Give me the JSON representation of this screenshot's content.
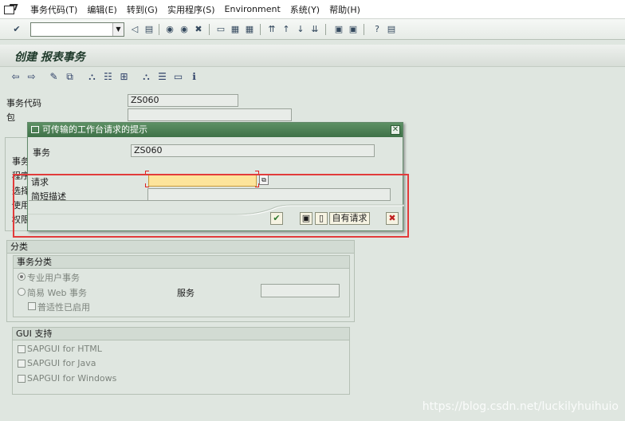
{
  "menubar": {
    "items": [
      {
        "label": "事务代码(T)"
      },
      {
        "label": "编辑(E)"
      },
      {
        "label": "转到(G)"
      },
      {
        "label": "实用程序(S)"
      },
      {
        "label": "Environment"
      },
      {
        "label": "系统(Y)"
      },
      {
        "label": "帮助(H)"
      }
    ]
  },
  "screen": {
    "title": "创建 报表事务",
    "tcode_label": "事务代码",
    "tcode_value": "ZS060",
    "package_label": "包",
    "package_value": "",
    "left_labels": [
      "事务",
      "程序",
      "选择",
      "使用",
      "权限"
    ],
    "classification": {
      "group_title": "分类",
      "sub_title": "事务分类",
      "radio1": "专业用户事务",
      "radio2": "简易 Web 事务",
      "checkbox": "普适性已启用",
      "service_label": "服务",
      "service_value": ""
    },
    "gui_support": {
      "title": "GUI 支持",
      "items": [
        "SAPGUI for HTML",
        "SAPGUI for Java",
        "SAPGUI for Windows"
      ]
    }
  },
  "dialog": {
    "title": "可传输的工作台请求的提示",
    "transaction_label": "事务",
    "transaction_value": "ZS060",
    "request_label": "请求",
    "request_value": "",
    "short_desc_label": "简短描述",
    "short_desc_value": "",
    "own_requests_label": "自有请求"
  },
  "watermark": "https://blog.csdn.net/luckilyhuihuio",
  "colors": {
    "background": "#dfe6e0",
    "dialog_title": "#4c7e55",
    "highlight_frame": "#e23b3b",
    "required_input": "#fde49b"
  }
}
